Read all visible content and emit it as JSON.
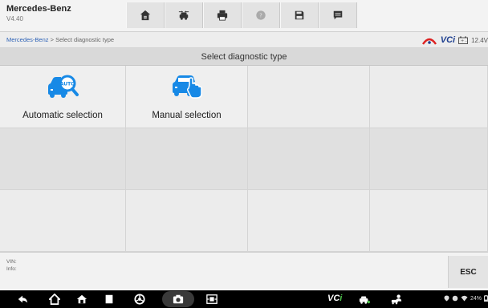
{
  "header": {
    "brand": "Mercedes-Benz",
    "version": "V4.40",
    "toolbar": [
      {
        "name": "home-icon"
      },
      {
        "name": "vehicle-swap-icon"
      },
      {
        "name": "print-icon"
      },
      {
        "name": "help-icon"
      },
      {
        "name": "save-icon"
      },
      {
        "name": "message-icon"
      }
    ]
  },
  "breadcrumb": {
    "root": "Mercedes-Benz",
    "separator": " > ",
    "current": "Select diagnostic type"
  },
  "status": {
    "vci_prefix": "VC",
    "vci_suffix": "i",
    "voltage": "12.4V"
  },
  "title": "Select diagnostic type",
  "options": [
    {
      "label": "Automatic selection",
      "icon": "auto-scan-car-icon"
    },
    {
      "label": "Manual selection",
      "icon": "manual-select-car-icon"
    }
  ],
  "info": {
    "vin_label": "VIN:",
    "info_label": "Info:"
  },
  "esc_label": "ESC",
  "navbar": {
    "vci_prefix": "VC",
    "vci_suffix": "i",
    "status_text": "24%"
  },
  "colors": {
    "accent_blue": "#1e3f8f",
    "link_blue": "#2f63b7",
    "icon_blue": "#1789e6",
    "vci_green": "#4cc24a"
  }
}
